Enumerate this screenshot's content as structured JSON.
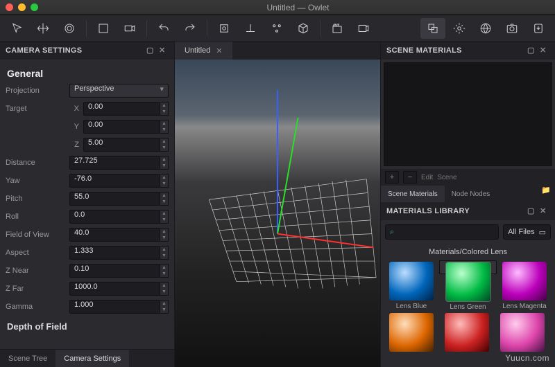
{
  "window": {
    "title": "Untitled — Owlet"
  },
  "left_panel": {
    "title": "CAMERA SETTINGS",
    "section_general": "General",
    "projection_label": "Projection",
    "projection_value": "Perspective",
    "target_label": "Target",
    "axis_x": "X",
    "axis_y": "Y",
    "axis_z": "Z",
    "target_x": "0.00",
    "target_y": "0.00",
    "target_z": "5.00",
    "distance_label": "Distance",
    "distance_value": "27.725",
    "yaw_label": "Yaw",
    "yaw_value": "-76.0",
    "pitch_label": "Pitch",
    "pitch_value": "55.0",
    "roll_label": "Roll",
    "roll_value": "0.0",
    "fov_label": "Field of View",
    "fov_value": "40.0",
    "aspect_label": "Aspect",
    "aspect_value": "1.333",
    "znear_label": "Z Near",
    "znear_value": "0.10",
    "zfar_label": "Z Far",
    "zfar_value": "1000.0",
    "gamma_label": "Gamma",
    "gamma_value": "1.000",
    "section_dof": "Depth of Field",
    "tab_scene_tree": "Scene Tree",
    "tab_camera_settings": "Camera Settings"
  },
  "viewport": {
    "tab_title": "Untitled"
  },
  "scene_materials": {
    "title": "SCENE MATERIALS",
    "btn_edit": "Edit",
    "btn_scene": "Scene",
    "tab_scene": "Scene Materials",
    "tab_node": "Node Nodes"
  },
  "materials_library": {
    "title": "MATERIALS LIBRARY",
    "filter": "All Files",
    "category": "Materials/Colored Lens",
    "items": [
      {
        "label": "Lens Blue"
      },
      {
        "label": "Lens Green"
      },
      {
        "label": "Lens Magenta"
      }
    ]
  },
  "watermark": "Yuucn.com"
}
